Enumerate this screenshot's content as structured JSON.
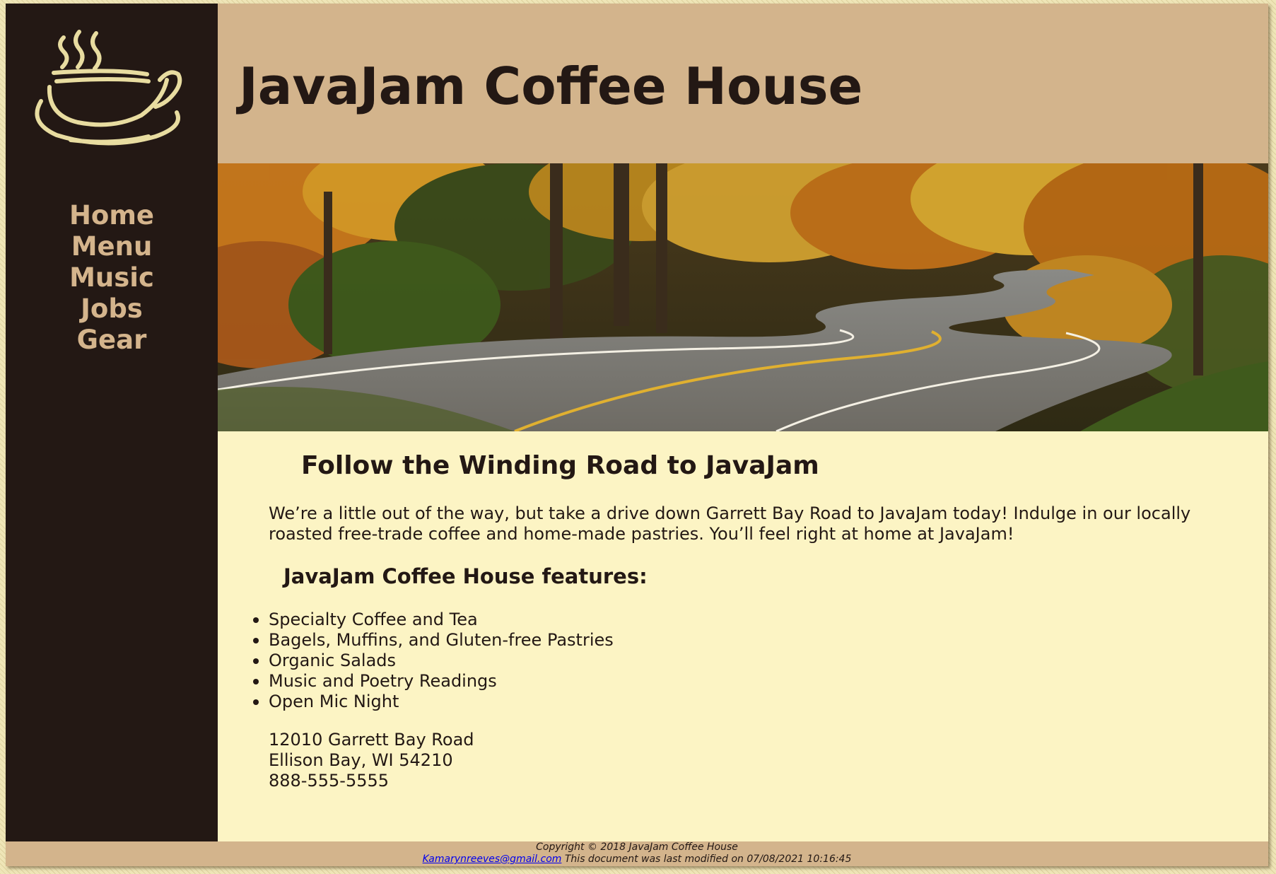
{
  "header": {
    "title": "JavaJam Coffee House"
  },
  "nav": {
    "items": [
      {
        "label": "Home"
      },
      {
        "label": "Menu"
      },
      {
        "label": "Music"
      },
      {
        "label": "Jobs"
      },
      {
        "label": "Gear"
      }
    ]
  },
  "main": {
    "heading": "Follow the Winding Road to JavaJam",
    "intro": "We’re a little out of the way, but take a drive down Garrett Bay Road to JavaJam today! Indulge in our locally roasted free-trade coffee and home-made pastries. You’ll feel right at home at JavaJam!",
    "features_heading": "JavaJam Coffee House features:",
    "features": [
      "Specialty Coffee and Tea",
      "Bagels, Muffins, and Gluten-free Pastries",
      "Organic Salads",
      "Music and Poetry Readings",
      "Open Mic Night"
    ],
    "address": {
      "street": "12010 Garrett Bay Road",
      "city": "Ellison Bay, WI 54210",
      "phone": "888-555-5555"
    }
  },
  "footer": {
    "copyright": "Copyright © 2018 JavaJam Coffee House",
    "email": "Kamarynreeves@gmail.com",
    "modified": "This document was last modified on 07/08/2021 10:16:45"
  },
  "colors": {
    "sidebar": "#231814",
    "tan": "#d3b48c",
    "content_bg": "#fcf4c4",
    "text": "#231814",
    "logo": "#e8dca0"
  },
  "icons": {
    "logo": "coffee-cup-icon"
  }
}
